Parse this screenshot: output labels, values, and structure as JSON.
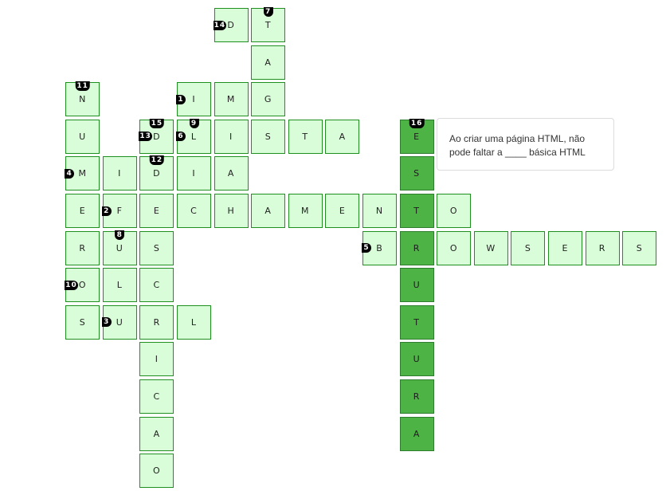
{
  "clue": {
    "text": "Ao criar uma página HTML, não pode faltar a ____ básica HTML"
  },
  "colors": {
    "cell_bg": "#d9fdd9",
    "cell_border": "#1f8f1f",
    "active_bg": "#4db345",
    "number_bg": "#000000"
  },
  "cells": [
    {
      "col": 6,
      "row": 0,
      "letter": "D",
      "num": "14",
      "pos": "left"
    },
    {
      "col": 7,
      "row": 0,
      "letter": "T",
      "num": "7",
      "pos": "top"
    },
    {
      "col": 7,
      "row": 1,
      "letter": "A"
    },
    {
      "col": 2,
      "row": 2,
      "letter": "N",
      "num": "11",
      "pos": "top"
    },
    {
      "col": 5,
      "row": 2,
      "letter": "I",
      "num": "1",
      "pos": "left"
    },
    {
      "col": 6,
      "row": 2,
      "letter": "M"
    },
    {
      "col": 7,
      "row": 2,
      "letter": "G"
    },
    {
      "col": 2,
      "row": 3,
      "letter": "U"
    },
    {
      "col": 4,
      "row": 3,
      "letter": "D",
      "nums": [
        {
          "num": "15",
          "pos": "top"
        },
        {
          "num": "13",
          "pos": "left"
        }
      ]
    },
    {
      "col": 5,
      "row": 3,
      "letter": "L",
      "nums": [
        {
          "num": "9",
          "pos": "top"
        },
        {
          "num": "6",
          "pos": "left"
        }
      ]
    },
    {
      "col": 6,
      "row": 3,
      "letter": "I"
    },
    {
      "col": 7,
      "row": 3,
      "letter": "S"
    },
    {
      "col": 8,
      "row": 3,
      "letter": "T"
    },
    {
      "col": 9,
      "row": 3,
      "letter": "A"
    },
    {
      "col": 11,
      "row": 3,
      "letter": "E",
      "num": "16",
      "pos": "top",
      "hl": true
    },
    {
      "col": 2,
      "row": 4,
      "letter": "M",
      "num": "4",
      "pos": "left"
    },
    {
      "col": 3,
      "row": 4,
      "letter": "I"
    },
    {
      "col": 4,
      "row": 4,
      "letter": "D",
      "num": "12",
      "pos": "top"
    },
    {
      "col": 5,
      "row": 4,
      "letter": "I"
    },
    {
      "col": 6,
      "row": 4,
      "letter": "A"
    },
    {
      "col": 11,
      "row": 4,
      "letter": "S",
      "hl": true
    },
    {
      "col": 2,
      "row": 5,
      "letter": "E"
    },
    {
      "col": 3,
      "row": 5,
      "letter": "F",
      "num": "2",
      "pos": "left"
    },
    {
      "col": 4,
      "row": 5,
      "letter": "E"
    },
    {
      "col": 5,
      "row": 5,
      "letter": "C"
    },
    {
      "col": 6,
      "row": 5,
      "letter": "H"
    },
    {
      "col": 7,
      "row": 5,
      "letter": "A"
    },
    {
      "col": 8,
      "row": 5,
      "letter": "M"
    },
    {
      "col": 9,
      "row": 5,
      "letter": "E"
    },
    {
      "col": 10,
      "row": 5,
      "letter": "N"
    },
    {
      "col": 11,
      "row": 5,
      "letter": "T",
      "hl": true
    },
    {
      "col": 12,
      "row": 5,
      "letter": "O"
    },
    {
      "col": 2,
      "row": 6,
      "letter": "R"
    },
    {
      "col": 3,
      "row": 6,
      "letter": "U",
      "num": "8",
      "pos": "top"
    },
    {
      "col": 4,
      "row": 6,
      "letter": "S"
    },
    {
      "col": 10,
      "row": 6,
      "letter": "B",
      "num": "5",
      "pos": "left"
    },
    {
      "col": 11,
      "row": 6,
      "letter": "R",
      "hl": true
    },
    {
      "col": 12,
      "row": 6,
      "letter": "O"
    },
    {
      "col": 13,
      "row": 6,
      "letter": "W"
    },
    {
      "col": 14,
      "row": 6,
      "letter": "S"
    },
    {
      "col": 15,
      "row": 6,
      "letter": "E"
    },
    {
      "col": 16,
      "row": 6,
      "letter": "R"
    },
    {
      "col": 17,
      "row": 6,
      "letter": "S"
    },
    {
      "col": 2,
      "row": 7,
      "letter": "O",
      "num": "10",
      "pos": "left"
    },
    {
      "col": 3,
      "row": 7,
      "letter": "L"
    },
    {
      "col": 4,
      "row": 7,
      "letter": "C"
    },
    {
      "col": 11,
      "row": 7,
      "letter": "U",
      "hl": true
    },
    {
      "col": 2,
      "row": 8,
      "letter": "S"
    },
    {
      "col": 3,
      "row": 8,
      "letter": "U",
      "num": "3",
      "pos": "left"
    },
    {
      "col": 4,
      "row": 8,
      "letter": "R"
    },
    {
      "col": 5,
      "row": 8,
      "letter": "L"
    },
    {
      "col": 11,
      "row": 8,
      "letter": "T",
      "hl": true
    },
    {
      "col": 4,
      "row": 9,
      "letter": "I"
    },
    {
      "col": 11,
      "row": 9,
      "letter": "U",
      "hl": true
    },
    {
      "col": 4,
      "row": 10,
      "letter": "C"
    },
    {
      "col": 11,
      "row": 10,
      "letter": "R",
      "hl": true
    },
    {
      "col": 4,
      "row": 11,
      "letter": "A"
    },
    {
      "col": 11,
      "row": 11,
      "letter": "A",
      "hl": true
    },
    {
      "col": 4,
      "row": 12,
      "letter": "O"
    }
  ]
}
